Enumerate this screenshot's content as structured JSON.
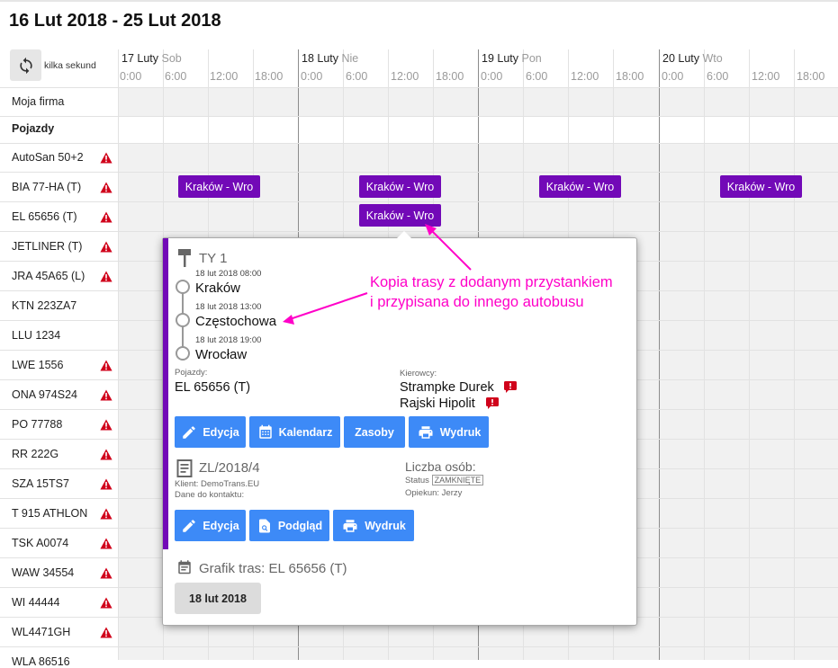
{
  "title": "16 Lut 2018 - 25 Lut 2018",
  "refresh_label": "kilka sekund",
  "days": [
    {
      "name": "17 Luty",
      "weekday": "Sob"
    },
    {
      "name": "18 Luty",
      "weekday": "Nie"
    },
    {
      "name": "19 Luty",
      "weekday": "Pon"
    },
    {
      "name": "20 Luty",
      "weekday": "Wto"
    }
  ],
  "hours": [
    "0:00",
    "6:00",
    "12:00",
    "18:00"
  ],
  "rows": {
    "company": "Moja firma",
    "vehicles_header": "Pojazdy",
    "vehicles": [
      {
        "name": "AutoSan 50+2",
        "warning": true
      },
      {
        "name": "BIA 77-HA (T)",
        "warning": true
      },
      {
        "name": "EL 65656 (T)",
        "warning": true
      },
      {
        "name": "JETLINER (T)",
        "warning": true
      },
      {
        "name": "JRA 45A65 (L)",
        "warning": true
      },
      {
        "name": "KTN 223ZA7",
        "warning": false
      },
      {
        "name": "LLU 1234",
        "warning": false
      },
      {
        "name": "LWE 1556",
        "warning": true
      },
      {
        "name": "ONA 974S24",
        "warning": true
      },
      {
        "name": "PO 77788",
        "warning": true
      },
      {
        "name": "RR 222G",
        "warning": true
      },
      {
        "name": "SZA 15TS7",
        "warning": true
      },
      {
        "name": "T 915 ATHLON",
        "warning": true
      },
      {
        "name": "TSK A0074",
        "warning": true
      },
      {
        "name": "WAW 34554",
        "warning": true
      },
      {
        "name": "WI 44444",
        "warning": true
      },
      {
        "name": "WL4471GH",
        "warning": true
      },
      {
        "name": "WLA 86516",
        "warning": false
      }
    ]
  },
  "trips": [
    "Kraków - Wro",
    "Kraków - Wro",
    "Kraków - Wro",
    "Kraków - Wro",
    "Kraków - Wro"
  ],
  "popup": {
    "route_code": "TY 1",
    "stops": [
      {
        "time": "18 lut 2018 08:00",
        "name": "Kraków"
      },
      {
        "time": "18 lut 2018 13:00",
        "name": "Częstochowa"
      },
      {
        "time": "18 lut 2018 19:00",
        "name": "Wrocław"
      }
    ],
    "vehicles_label": "Pojazdy:",
    "vehicle": "EL 65656 (T)",
    "drivers_label": "Kierowcy:",
    "drivers": [
      "Strampke Durek",
      "Rajski Hipolit"
    ],
    "buttons1": {
      "edit": "Edycja",
      "calendar": "Kalendarz",
      "resources": "Zasoby",
      "print": "Wydruk"
    },
    "order": {
      "number": "ZL/2018/4",
      "client": "Klient: DemoTrans.EU",
      "contact": "Dane do kontaktu:",
      "persons": "Liczba osób:",
      "status_label": "Status",
      "status": "ZAMKNIĘTE",
      "caretaker": "Opiekun: Jerzy"
    },
    "buttons2": {
      "edit": "Edycja",
      "preview": "Podgląd",
      "print": "Wydruk"
    },
    "schedule_title": "Grafik tras: EL 65656 (T)",
    "schedule_date": "18 lut 2018"
  },
  "annotation": [
    "Kopia trasy z dodanym przystankiem",
    "i przypisana do innego autobusu"
  ],
  "colors": {
    "trip": "#7209b7",
    "button": "#3d8af7",
    "annotation": "#ff00c8",
    "warning": "#d0021b"
  }
}
